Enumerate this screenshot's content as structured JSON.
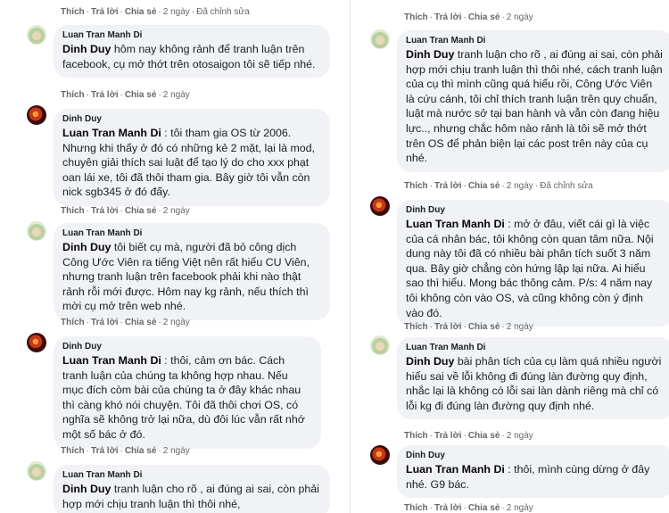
{
  "left": {
    "top_actions": {
      "like": "Thích",
      "reply": "Trả lời",
      "share": "Chia sẻ",
      "time": "2 ngày",
      "edited": "Đã chỉnh sửa"
    },
    "comments": [
      {
        "author": "Luan Tran Manh Di",
        "tag": "Dinh Duy",
        "text": " hôm nay không rảnh để tranh luận trên facebook, cụ mở thớt trên otosaigon tôi sẽ tiếp nhé.",
        "actions": {
          "like": "Thích",
          "reply": "Trả lời",
          "share": "Chia sẻ",
          "time": "2 ngày"
        }
      },
      {
        "author": "Dinh Duy",
        "tag": "Luan Tran Manh Di",
        "text": " : tôi tham gia OS từ 2006. Nhưng khi thấy ở đó có những kẻ 2 mặt, lại là mod, chuyên giải thích sai luật để tạo lý do cho xxx phạt oan lái xe, tôi đã thôi tham gia. Bây giờ tôi vẫn còn nick sgb345 ở đó đấy.",
        "actions": {
          "like": "Thích",
          "reply": "Trả lời",
          "share": "Chia sẻ",
          "time": "2 ngày"
        }
      },
      {
        "author": "Luan Tran Manh Di",
        "tag": "Dinh Duy",
        "text": " tôi biết cụ mà, người đã bỏ công dịch Công Ước Viên ra tiếng Việt nên rất hiểu CU Viên, nhưng tranh luận trên facebook phải khi nào thật rảnh rỗi mới được. Hôm nay kg rảnh, nếu thích thì mời cụ mở trên web nhé.",
        "actions": {
          "like": "Thích",
          "reply": "Trả lời",
          "share": "Chia sẻ",
          "time": "2 ngày"
        }
      },
      {
        "author": "Dinh Duy",
        "tag": "Luan Tran Manh Di",
        "text": " : thôi, cảm ơn bác. Cách tranh luận của chúng ta không hợp nhau. Nếu mục đích còm bài của chúng ta ở đây khác nhau thì càng khó nói chuyện. Tôi đã thôi chơi OS, có nghĩa sẽ không trở lại nữa, dù đôi lúc vẫn rất nhớ một số bác ở đó.",
        "actions": {
          "like": "Thích",
          "reply": "Trả lời",
          "share": "Chia sẻ",
          "time": "2 ngày"
        }
      },
      {
        "author": "Luan Tran Manh Di",
        "tag": "Dinh Duy",
        "text": " tranh luận cho rõ , ai đúng ai sai, còn phải hợp mới chịu tranh luận thì thôi nhé,"
      }
    ]
  },
  "right": {
    "top_actions": {
      "like": "Thích",
      "reply": "Trả lời",
      "share": "Chia sẻ",
      "time": "2 ngày"
    },
    "comments": [
      {
        "author": "Luan Tran Manh Di",
        "tag": "Dinh Duy",
        "text": " tranh luận cho rõ , ai đúng ai sai, còn phải hợp mới chịu tranh luận thì thôi nhé, cách tranh luận của cụ thì mình cũng quá hiểu rồi, Công Ước Viên là cứu cánh, tôi chỉ thích tranh luận trên quy chuẩn, luật mà nước sở tại ban hành và vẫn còn đang hiệu lực.., nhưng chắc hôm nào rảnh là tôi sẽ mở thớt trên OS để phản biện lại các post trên này của cụ nhé.",
        "actions": {
          "like": "Thích",
          "reply": "Trả lời",
          "share": "Chia sẻ",
          "time": "2 ngày",
          "edited": "Đã chỉnh sửa"
        }
      },
      {
        "author": "Dinh Duy",
        "tag": "Luan Tran Manh Di",
        "text": " : mở ở đâu, viết cái gì là việc của cá nhân bác, tôi không còn quan tâm nữa. Nội dung này tôi đã có nhiều bài phân tích suốt 3 năm qua. Bây giờ chẳng còn hứng lập lại nữa. Ai hiểu sao thì hiểu. Mong bác thông cảm. P/s: 4 năm nay tôi không còn vào OS, và cũng không còn ý định vào đó.",
        "actions": {
          "like": "Thích",
          "reply": "Trả lời",
          "share": "Chia sẻ",
          "time": "2 ngày"
        }
      },
      {
        "author": "Luan Tran Manh Di",
        "tag": "Dinh Duy",
        "text": " bài phân tích của cụ làm quá nhiều người hiểu sai về lỗi không đi đúng làn đường quy định, nhắc lại là không có lỗi sai làn dành riêng mà chỉ có lỗi kg đi đúng làn đường quy định nhé.",
        "actions": {
          "like": "Thích",
          "reply": "Trả lời",
          "share": "Chia sẻ",
          "time": "2 ngày"
        }
      },
      {
        "author": "Dinh Duy",
        "tag": "Luan Tran Manh Di",
        "text": " : thôi, mình cùng dừng ở đây nhé. G9 bác.",
        "actions": {
          "like": "Thích",
          "reply": "Trả lời",
          "share": "Chia sẻ",
          "time": "2 ngày"
        }
      }
    ]
  }
}
